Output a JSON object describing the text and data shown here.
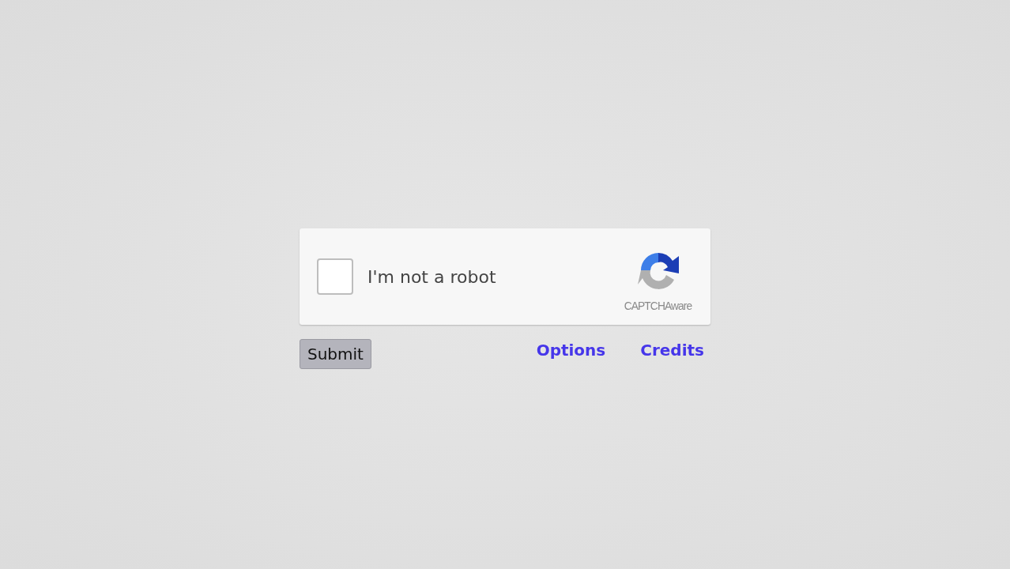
{
  "captcha": {
    "checked": false,
    "label": "I'm not a robot",
    "brand": "CAPTCHAware"
  },
  "submit_button": "Submit",
  "links": [
    "Options",
    "Credits"
  ]
}
